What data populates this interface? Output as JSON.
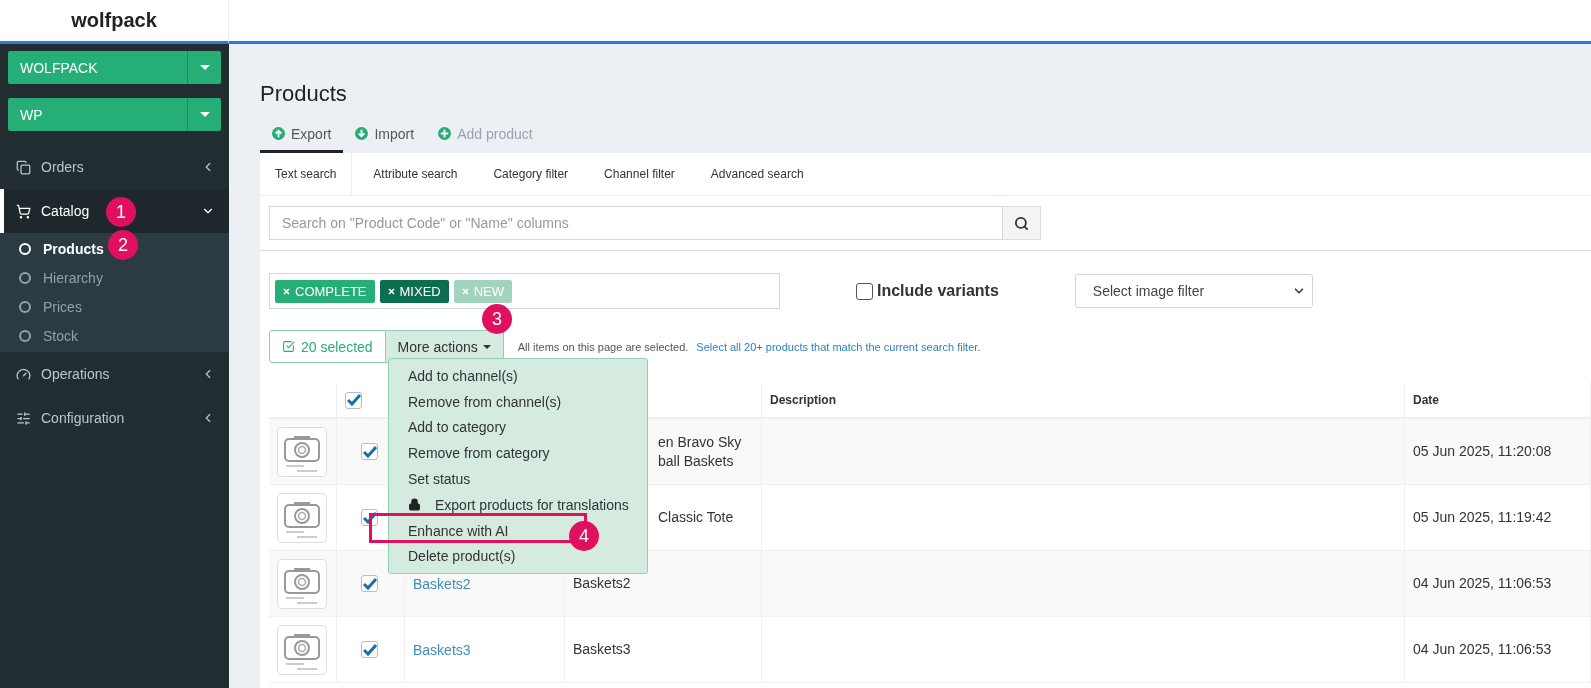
{
  "brand": "wolfpack",
  "sidebar": {
    "selectors": [
      {
        "label": "WOLFPACK"
      },
      {
        "label": "WP"
      }
    ],
    "items": [
      {
        "label": "Orders",
        "expanded": false,
        "selected": false
      },
      {
        "label": "Catalog",
        "expanded": true,
        "selected": true,
        "children": [
          {
            "label": "Products",
            "selected": true
          },
          {
            "label": "Hierarchy",
            "selected": false
          },
          {
            "label": "Prices",
            "selected": false
          },
          {
            "label": "Stock",
            "selected": false
          }
        ]
      },
      {
        "label": "Operations",
        "expanded": false,
        "selected": false
      },
      {
        "label": "Configuration",
        "expanded": false,
        "selected": false
      }
    ]
  },
  "page": {
    "title": "Products",
    "actions": [
      {
        "label": "Export",
        "kind": "export",
        "selected": true,
        "disabled": false
      },
      {
        "label": "Import",
        "kind": "import",
        "selected": false,
        "disabled": false
      },
      {
        "label": "Add product",
        "kind": "add",
        "selected": false,
        "disabled": true
      }
    ],
    "search_tabs": [
      {
        "label": "Text search",
        "selected": true
      },
      {
        "label": "Attribute search",
        "selected": false
      },
      {
        "label": "Category filter",
        "selected": false
      },
      {
        "label": "Channel filter",
        "selected": false
      },
      {
        "label": "Advanced search",
        "selected": false
      }
    ],
    "search": {
      "placeholder": "Search on \"Product Code\" or \"Name\" columns"
    },
    "status_tags": [
      {
        "label": "COMPLETE",
        "color": "#26ae77"
      },
      {
        "label": "MIXED",
        "color": "#0b6e4f"
      },
      {
        "label": "NEW",
        "color": "#a2d3bc"
      }
    ],
    "include_variants": {
      "label": "Include variants",
      "checked": false
    },
    "image_filter": {
      "value": "Select image filter"
    },
    "selection": {
      "count": "20 selected",
      "more_actions": "More actions",
      "notice": "All items on this page are selected.",
      "link": "Select all 20+ products that match the current search filter."
    },
    "actions_menu": {
      "expanded": true,
      "items": [
        {
          "label": "Add to channel(s)",
          "locked": false
        },
        {
          "label": "Remove from channel(s)",
          "locked": false
        },
        {
          "label": "Add to category",
          "locked": false
        },
        {
          "label": "Remove from category",
          "locked": false
        },
        {
          "label": "Set status",
          "locked": false
        },
        {
          "label": "Export products for translations",
          "locked": true
        },
        {
          "label": "Enhance with AI",
          "locked": false
        },
        {
          "label": "Delete product(s)",
          "locked": false
        }
      ]
    },
    "table": {
      "header_checked": true,
      "columns": [
        "Description",
        "Date"
      ],
      "rows": [
        {
          "checked": true,
          "name": [
            "en Bravo Sky",
            "ball Baskets"
          ],
          "name_partly_hidden": true,
          "date": "05 Jun 2025, 11:20:08"
        },
        {
          "checked": true,
          "name": [
            "Classic Tote"
          ],
          "name_partly_hidden": true,
          "date": "05 Jun 2025, 11:19:42"
        },
        {
          "checked": true,
          "code": "Baskets2",
          "name": [
            "Baskets2"
          ],
          "name_partly_hidden": false,
          "date": "04 Jun 2025, 11:06:53"
        },
        {
          "checked": true,
          "code": "Baskets3",
          "name": [
            "Baskets3"
          ],
          "name_partly_hidden": false,
          "date": "04 Jun 2025, 11:06:53"
        }
      ]
    }
  },
  "annotations": [
    {
      "label": "1"
    },
    {
      "label": "2"
    },
    {
      "label": "3"
    },
    {
      "label": "4"
    }
  ]
}
